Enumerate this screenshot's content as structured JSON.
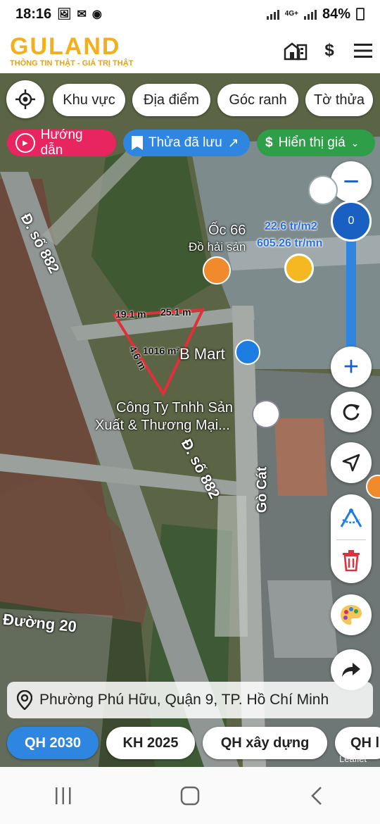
{
  "status": {
    "time": "18:16",
    "left_icons": [
      "image-icon",
      "mail-icon",
      "app-icon"
    ],
    "network": "4G+",
    "battery": "84%"
  },
  "header": {
    "logo": "GULAND",
    "tagline": "THÔNG TIN THẬT - GIÁ TRỊ THẬT",
    "icons": [
      "buildings-icon",
      "dollar-icon",
      "menu-icon"
    ],
    "dollar_glyph": "$"
  },
  "chips": {
    "area": "Khu vực",
    "place": "Địa điểm",
    "corner": "Góc ranh",
    "parcel": "Tờ thửa"
  },
  "pills": {
    "guide": "Hướng dẫn",
    "saved": "Thửa đã lưu",
    "show_price": "Hiển thị giá"
  },
  "zoom": {
    "minus": "−",
    "plus": "+",
    "level": "0",
    "price_m2": "22.6 tr/m2",
    "price_total": "605.26 tr/mn"
  },
  "parcel": {
    "side_top_left": "19.1 m",
    "side_top_right": "25.1 m",
    "side_diagonal": "4.6 m",
    "area": "1016 m²"
  },
  "map_labels": {
    "road_882_top": "Đ. số 882",
    "road_882_bottom": "Đ. số 882",
    "place_oc66": "Ốc 66",
    "place_oc66_sub": "Đồ hải sản",
    "place_bmart": "B Mart",
    "company_line1": "Công Ty Tnhh Sản",
    "company_line2": "Xuất & Thương Mại...",
    "road_go_cat": "Gò Cát",
    "road_20": "Đường 20",
    "attribution": "Leaflet"
  },
  "address": {
    "text": "Phường Phú Hữu, Quận 9, TP. Hồ Chí Minh"
  },
  "bottom_tabs": [
    "QH 2030",
    "KH 2025",
    "QH xây dựng",
    "QH l"
  ],
  "colors": {
    "brand": "#f2b01e",
    "guide": "#e8255f",
    "saved": "#2f86e0",
    "price": "#2e9e48",
    "active_tab": "#2f86e0",
    "parcel_outline": "#e0303a"
  }
}
